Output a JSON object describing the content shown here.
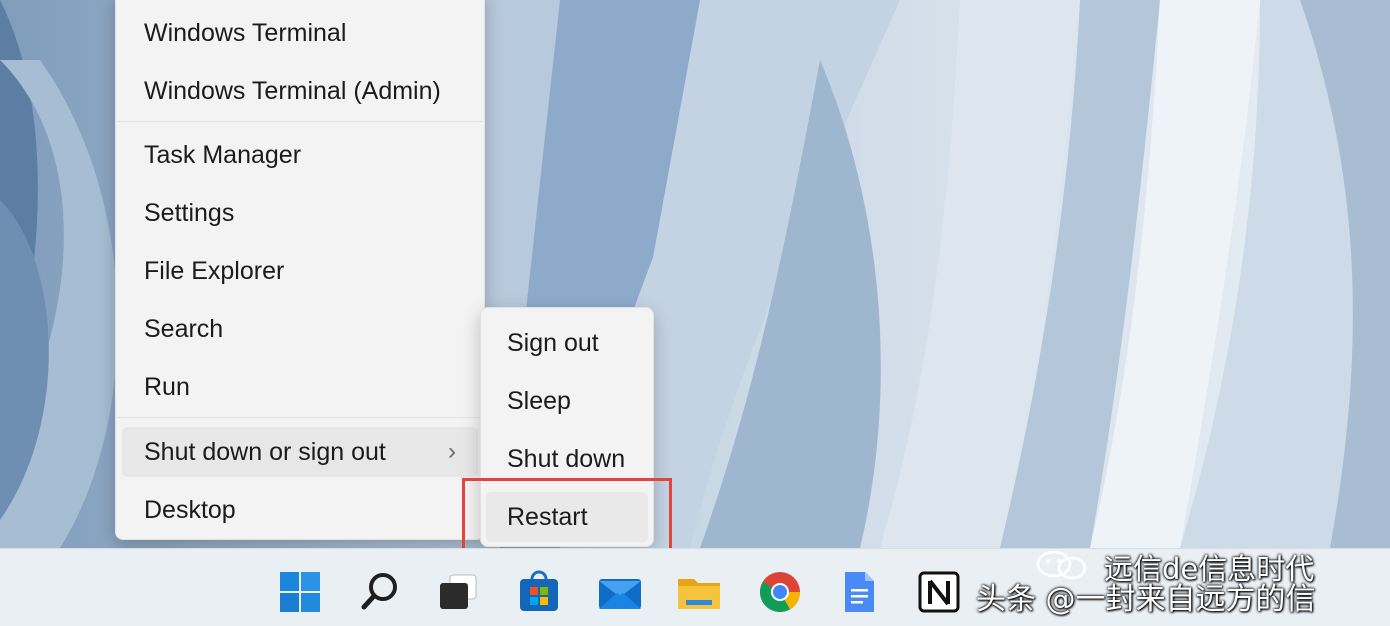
{
  "context_menu": {
    "items": [
      {
        "label": "Windows Terminal"
      },
      {
        "label": "Windows Terminal (Admin)"
      },
      {
        "label": "Task Manager"
      },
      {
        "label": "Settings"
      },
      {
        "label": "File Explorer"
      },
      {
        "label": "Search"
      },
      {
        "label": "Run"
      },
      {
        "label": "Shut down or sign out",
        "submenu_indicator": "chevron-right-icon"
      },
      {
        "label": "Desktop"
      }
    ]
  },
  "submenu": {
    "items": [
      {
        "label": "Sign out"
      },
      {
        "label": "Sleep"
      },
      {
        "label": "Shut down"
      },
      {
        "label": "Restart"
      }
    ],
    "highlight_color": "#e0463e"
  },
  "taskbar": {
    "icons": [
      "windows-start-icon",
      "search-icon",
      "task-view-icon",
      "store-icon",
      "mail-icon",
      "file-explorer-icon",
      "chrome-icon",
      "google-docs-icon",
      "notion-icon"
    ]
  },
  "watermark": {
    "line1": "远信de信息时代",
    "line2": "头条 @一封来自远方的信"
  },
  "colors": {
    "menu_bg": "#f3f3f3",
    "taskbar_bg": "#eaeff4",
    "accent": "#0078d4"
  }
}
